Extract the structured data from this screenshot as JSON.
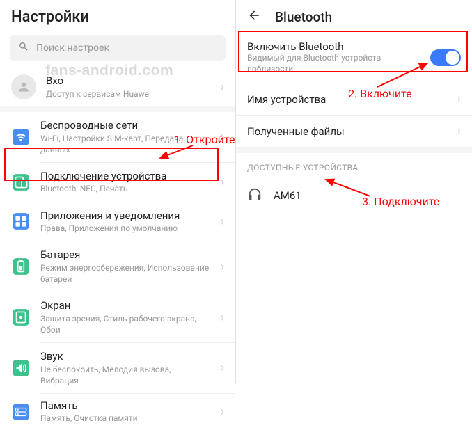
{
  "watermark": "fans-android.com",
  "left": {
    "title": "Настройки",
    "search_placeholder": "Поиск настроек",
    "account": {
      "title": "Вхо",
      "subtitle": "Доступ к сервисам Huawei"
    },
    "items": [
      {
        "title": "Беспроводные сети",
        "subtitle": "Wi-Fi, Настройки SIM-карт, Передача данных",
        "icon": "wifi",
        "color": "#4a8df0"
      },
      {
        "title": "Подключение устройства",
        "subtitle": "Bluetooth, NFC, Печать",
        "icon": "device",
        "color": "#3fc18e"
      },
      {
        "title": "Приложения и уведомления",
        "subtitle": "Права, Приложения по умолчанию",
        "icon": "apps",
        "color": "#4a8df0"
      },
      {
        "title": "Батарея",
        "subtitle": "Режим энергосбережения, Использование батареи",
        "icon": "battery",
        "color": "#3fc18e"
      },
      {
        "title": "Экран",
        "subtitle": "Защита зрения, Стиль рабочего экрана, Обои",
        "icon": "display",
        "color": "#3fc18e"
      },
      {
        "title": "Звук",
        "subtitle": "Не беспокоить, Мелодия вызова, Вибрация",
        "icon": "sound",
        "color": "#3fc18e"
      },
      {
        "title": "Память",
        "subtitle": "Память, Очистка памяти",
        "icon": "storage",
        "color": "#4a8df0"
      }
    ]
  },
  "right": {
    "title": "Bluetooth",
    "enable": {
      "title": "Включить Bluetooth",
      "subtitle": "Видимый для Bluetooth-устройств поблизости"
    },
    "rows": [
      {
        "title": "Имя устройства"
      },
      {
        "title": "Полученные файлы"
      }
    ],
    "section_header": "ДОСТУПНЫЕ УСТРОЙСТВА",
    "device": "AM61"
  },
  "annotations": {
    "a1": "1. Откройте",
    "a2": "2. Включите",
    "a3": "3. Подключите"
  }
}
